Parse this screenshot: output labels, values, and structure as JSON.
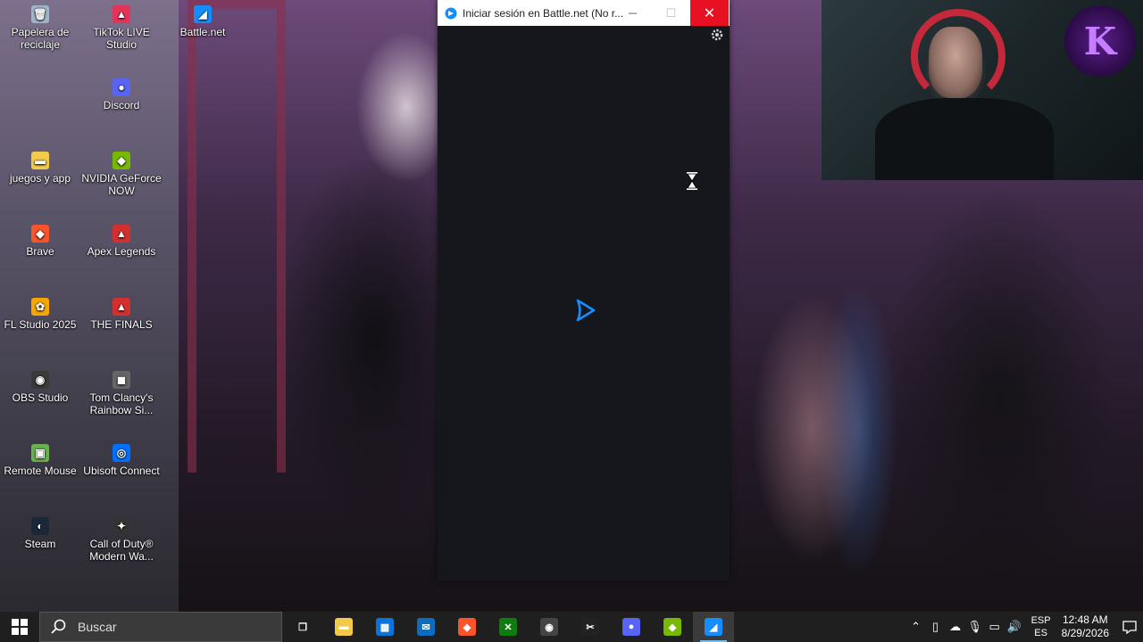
{
  "desktop": {
    "icons": [
      {
        "label": "Papelera de\nreciclaje",
        "glyph": "🗑",
        "color": "#9fb4c8"
      },
      {
        "label": "TikTok LIVE Studio",
        "glyph": "▲",
        "color": "#e3335b"
      },
      {
        "label": "Battle.net",
        "glyph": "◢",
        "color": "#148eff"
      },
      {
        "label": "Discord",
        "glyph": "●",
        "color": "#5865f2"
      },
      {
        "label": "juegos y app",
        "glyph": "▬",
        "color": "#f3c94a"
      },
      {
        "label": "NVIDIA GeForce NOW",
        "glyph": "◆",
        "color": "#76b900"
      },
      {
        "label": "Brave",
        "glyph": "◆",
        "color": "#fb542b"
      },
      {
        "label": "Apex Legends",
        "glyph": "▲",
        "color": "#d32f2f"
      },
      {
        "label": "FL Studio 2025",
        "glyph": "✿",
        "color": "#f7a600"
      },
      {
        "label": "THE FINALS",
        "glyph": "▲",
        "color": "#d32f2f"
      },
      {
        "label": "OBS Studio",
        "glyph": "◉",
        "color": "#3a3a3a"
      },
      {
        "label": "Tom Clancy's Rainbow Si...",
        "glyph": "◼",
        "color": "#666666"
      },
      {
        "label": "Remote Mouse",
        "glyph": "▣",
        "color": "#6ab04c"
      },
      {
        "label": "Ubisoft Connect",
        "glyph": "◎",
        "color": "#0070ff"
      },
      {
        "label": "Steam",
        "glyph": "◐",
        "color": "#1b2838"
      },
      {
        "label": "Call of Duty® Modern Wa...",
        "glyph": "✦",
        "color": "#333333"
      }
    ]
  },
  "window": {
    "title": "Iniciar sesión en Battle.net (No r...",
    "accent": "#148eff",
    "background": "#15171d"
  },
  "taskbar": {
    "search_placeholder": "Buscar",
    "apps": [
      {
        "name": "task-view",
        "glyph": "❐",
        "color": "transparent"
      },
      {
        "name": "file-explorer",
        "glyph": "▬",
        "color": "#f3c94a"
      },
      {
        "name": "microsoft-store",
        "glyph": "▦",
        "color": "#0a74d9"
      },
      {
        "name": "outlook",
        "glyph": "✉",
        "color": "#0f6cbd"
      },
      {
        "name": "brave",
        "glyph": "◆",
        "color": "#fb542b"
      },
      {
        "name": "xbox",
        "glyph": "✕",
        "color": "#107c10"
      },
      {
        "name": "obs",
        "glyph": "◉",
        "color": "#444444"
      },
      {
        "name": "capcut",
        "glyph": "✂",
        "color": "#222222"
      },
      {
        "name": "discord",
        "glyph": "●",
        "color": "#5865f2"
      },
      {
        "name": "nvidia",
        "glyph": "◆",
        "color": "#76b900"
      },
      {
        "name": "battle-net",
        "glyph": "◢",
        "color": "#148eff"
      }
    ],
    "language_top": "ESP",
    "language_bottom": "ES",
    "time": "12:48 AM",
    "date": "8/29/2026"
  },
  "overlay": {
    "logo_letter": "K"
  }
}
